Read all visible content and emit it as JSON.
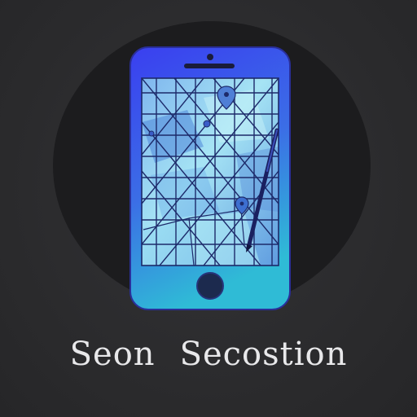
{
  "caption": {
    "word1": "Seon",
    "word2": "Secostion"
  },
  "colors": {
    "background": "#2c2c2e",
    "disc": "#1c1c1e",
    "phone_top": "#3b3ef0",
    "phone_bottom": "#2fb8d8",
    "screen_light": "#9fe6f2",
    "screen_dark": "#4f7cd8",
    "grid_lines": "#1d2a6a",
    "stylus": "#1a2060",
    "caption_text": "#e8e8ea"
  },
  "icons": [
    "smartphone-icon",
    "stylus-icon",
    "map-pin-icon",
    "home-button-icon"
  ]
}
